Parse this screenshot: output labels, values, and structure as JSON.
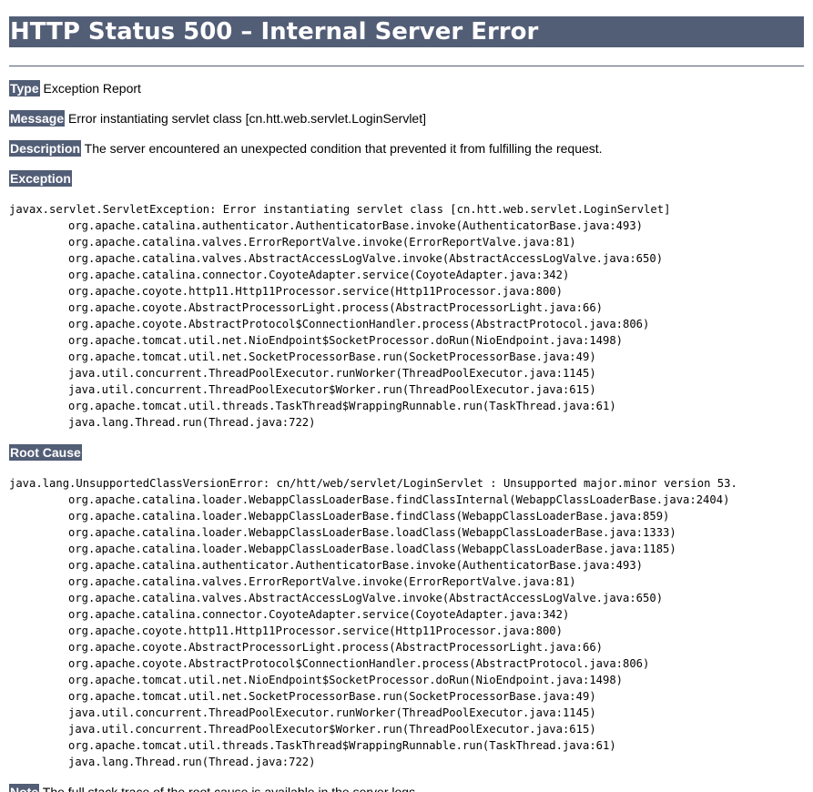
{
  "page": {
    "title": "HTTP Status 500 – Internal Server Error"
  },
  "fields": {
    "type": {
      "label": "Type",
      "value": "Exception Report"
    },
    "message": {
      "label": "Message",
      "value": "Error instantiating servlet class [cn.htt.web.servlet.LoginServlet]"
    },
    "description": {
      "label": "Description",
      "value": "The server encountered an unexpected condition that prevented it from fulfilling the request."
    }
  },
  "exception": {
    "label": "Exception",
    "head": "javax.servlet.ServletException: Error instantiating servlet class [cn.htt.web.servlet.LoginServlet]",
    "frames": [
      "org.apache.catalina.authenticator.AuthenticatorBase.invoke(AuthenticatorBase.java:493)",
      "org.apache.catalina.valves.ErrorReportValve.invoke(ErrorReportValve.java:81)",
      "org.apache.catalina.valves.AbstractAccessLogValve.invoke(AbstractAccessLogValve.java:650)",
      "org.apache.catalina.connector.CoyoteAdapter.service(CoyoteAdapter.java:342)",
      "org.apache.coyote.http11.Http11Processor.service(Http11Processor.java:800)",
      "org.apache.coyote.AbstractProcessorLight.process(AbstractProcessorLight.java:66)",
      "org.apache.coyote.AbstractProtocol$ConnectionHandler.process(AbstractProtocol.java:806)",
      "org.apache.tomcat.util.net.NioEndpoint$SocketProcessor.doRun(NioEndpoint.java:1498)",
      "org.apache.tomcat.util.net.SocketProcessorBase.run(SocketProcessorBase.java:49)",
      "java.util.concurrent.ThreadPoolExecutor.runWorker(ThreadPoolExecutor.java:1145)",
      "java.util.concurrent.ThreadPoolExecutor$Worker.run(ThreadPoolExecutor.java:615)",
      "org.apache.tomcat.util.threads.TaskThread$WrappingRunnable.run(TaskThread.java:61)",
      "java.lang.Thread.run(Thread.java:722)"
    ]
  },
  "root_cause": {
    "label": "Root Cause",
    "head": "java.lang.UnsupportedClassVersionError: cn/htt/web/servlet/LoginServlet : Unsupported major.minor version 53.",
    "frames": [
      "org.apache.catalina.loader.WebappClassLoaderBase.findClassInternal(WebappClassLoaderBase.java:2404)",
      "org.apache.catalina.loader.WebappClassLoaderBase.findClass(WebappClassLoaderBase.java:859)",
      "org.apache.catalina.loader.WebappClassLoaderBase.loadClass(WebappClassLoaderBase.java:1333)",
      "org.apache.catalina.loader.WebappClassLoaderBase.loadClass(WebappClassLoaderBase.java:1185)",
      "org.apache.catalina.authenticator.AuthenticatorBase.invoke(AuthenticatorBase.java:493)",
      "org.apache.catalina.valves.ErrorReportValve.invoke(ErrorReportValve.java:81)",
      "org.apache.catalina.valves.AbstractAccessLogValve.invoke(AbstractAccessLogValve.java:650)",
      "org.apache.catalina.connector.CoyoteAdapter.service(CoyoteAdapter.java:342)",
      "org.apache.coyote.http11.Http11Processor.service(Http11Processor.java:800)",
      "org.apache.coyote.AbstractProcessorLight.process(AbstractProcessorLight.java:66)",
      "org.apache.coyote.AbstractProtocol$ConnectionHandler.process(AbstractProtocol.java:806)",
      "org.apache.tomcat.util.net.NioEndpoint$SocketProcessor.doRun(NioEndpoint.java:1498)",
      "org.apache.tomcat.util.net.SocketProcessorBase.run(SocketProcessorBase.java:49)",
      "java.util.concurrent.ThreadPoolExecutor.runWorker(ThreadPoolExecutor.java:1145)",
      "java.util.concurrent.ThreadPoolExecutor$Worker.run(ThreadPoolExecutor.java:615)",
      "org.apache.tomcat.util.threads.TaskThread$WrappingRunnable.run(TaskThread.java:61)",
      "java.lang.Thread.run(Thread.java:722)"
    ]
  },
  "footer": {
    "label": "Note",
    "value": "The full stack trace of the root cause is available in the server logs."
  },
  "colors": {
    "header_bg": "#525d76",
    "header_text": "#ffffff",
    "body_text": "#000000",
    "background": "#ffffff"
  }
}
